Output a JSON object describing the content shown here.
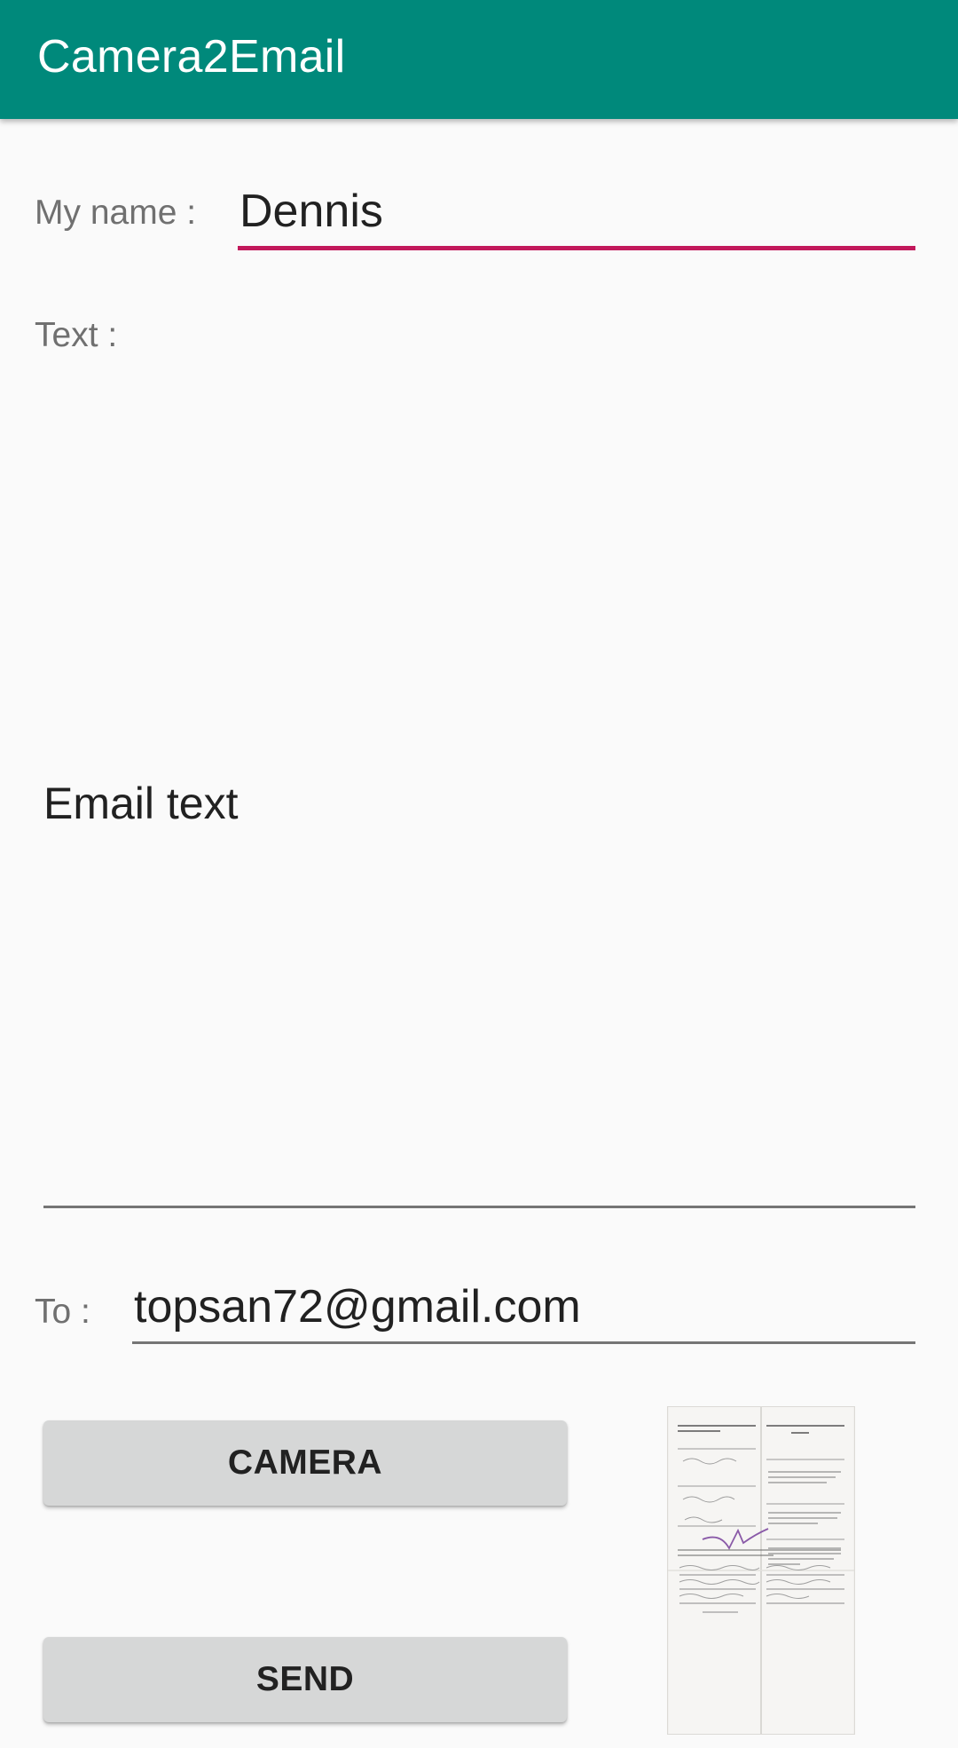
{
  "app": {
    "title": "Camera2Email"
  },
  "form": {
    "name_label": "My name :",
    "name_value": "Dennis",
    "text_label": "Text :",
    "email_text_value": "Email text",
    "to_label": "To :",
    "to_value": "topsan72@gmail.com"
  },
  "buttons": {
    "camera_label": "CAMERA",
    "send_label": "SEND"
  },
  "colors": {
    "appbar": "#00897b",
    "accent_underline": "#c2185b",
    "button_bg": "#d6d7d7"
  },
  "icons": {
    "thumbnail": "captured-document-photo"
  }
}
